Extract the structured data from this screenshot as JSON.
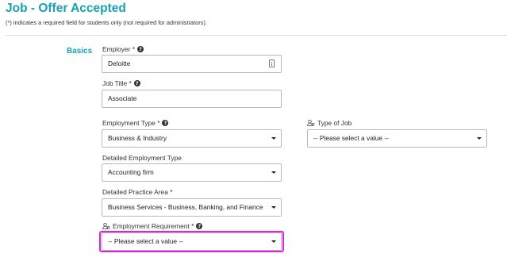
{
  "page": {
    "title": "Job - Offer Accepted",
    "required_note": "(*) indicates a required field for students only (not required for administrators)."
  },
  "section": {
    "label": "Basics"
  },
  "fields": {
    "employer": {
      "label": "Employer *",
      "value": "Deloitte",
      "icon": "lookup-icon"
    },
    "job_title": {
      "label": "Job Title *",
      "value": "Associate"
    },
    "employment_type": {
      "label": "Employment Type *",
      "value": "Business & Industry"
    },
    "type_of_job": {
      "label": "Type of Job",
      "value": "-- Please select a value --"
    },
    "detailed_employment_type": {
      "label": "Detailed Employment Type",
      "value": "Accounting firm"
    },
    "detailed_practice_area": {
      "label": "Detailed Practice Area *",
      "value": "Business Services - Business, Banking, and Finance"
    },
    "employment_requirement": {
      "label": "Employment Requirement *",
      "value": "-- Please select a value --"
    }
  },
  "colors": {
    "accent": "#16a2b3",
    "highlight": "#e61de6"
  }
}
